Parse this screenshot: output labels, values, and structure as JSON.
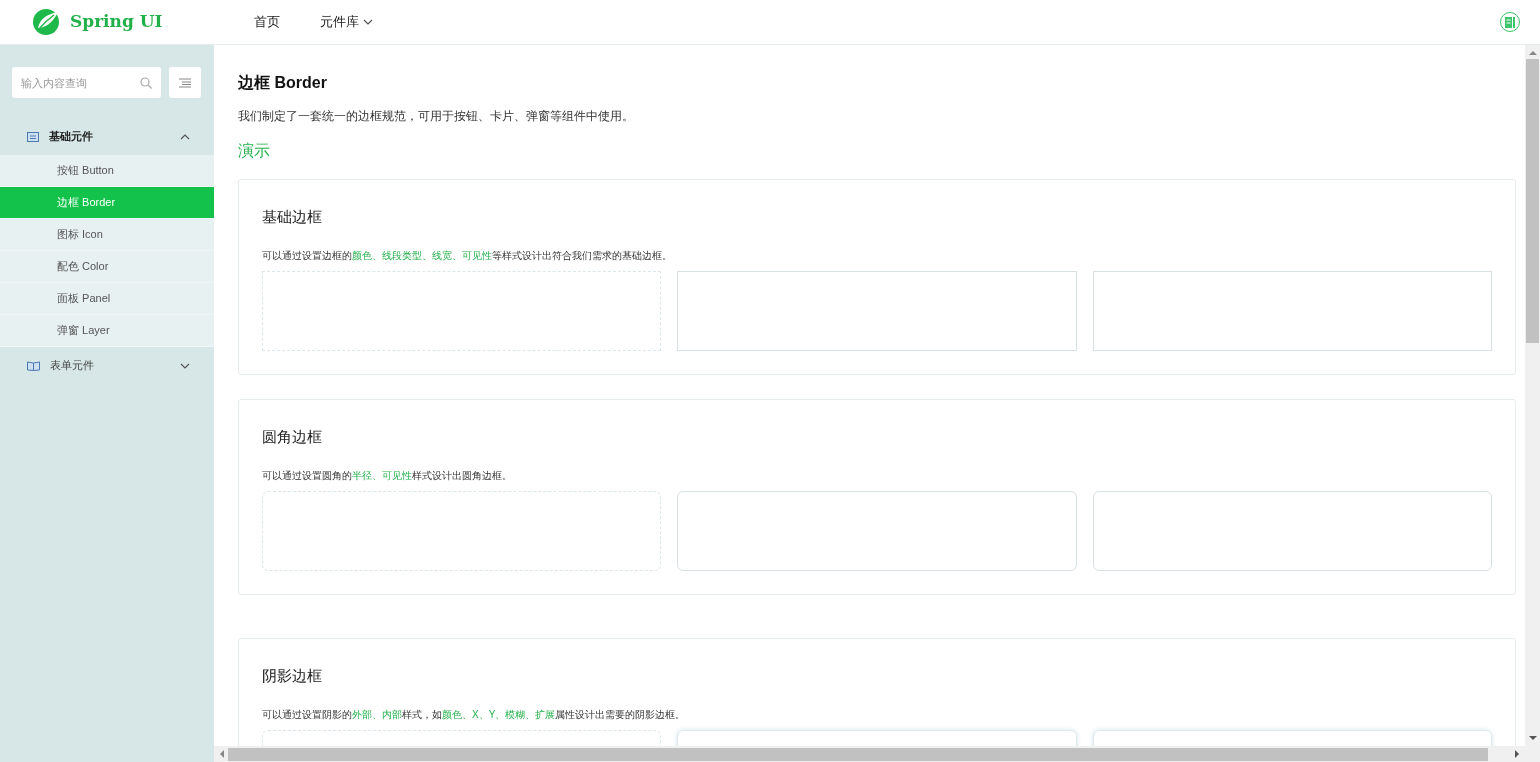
{
  "header": {
    "logo_text": "Spring UI",
    "nav": [
      {
        "label": "首页",
        "dropdown": false
      },
      {
        "label": "元件库",
        "dropdown": true
      }
    ]
  },
  "sidebar": {
    "search": {
      "placeholder": "输入内容查询"
    },
    "groups": [
      {
        "label": "基础元件",
        "expanded": true,
        "children": [
          {
            "label": "按钮 Button",
            "selected": false
          },
          {
            "label": "边框 Border",
            "selected": true
          },
          {
            "label": "图标 Icon",
            "selected": false
          },
          {
            "label": "配色 Color",
            "selected": false
          },
          {
            "label": "面板 Panel",
            "selected": false
          },
          {
            "label": "弹窗 Layer",
            "selected": false
          }
        ]
      },
      {
        "label": "表单元件",
        "expanded": false
      }
    ]
  },
  "page": {
    "title": "边框 Border",
    "intro": "我们制定了一套统一的边框规范，可用于按钮、卡片、弹窗等组件中使用。",
    "demo_heading": "演示",
    "sections": [
      {
        "title": "基础边框",
        "rounded": false,
        "description": [
          {
            "text": "可以通过设置边框的",
            "highlight": false
          },
          {
            "text": "颜色、线段类型、线宽、可见性",
            "highlight": true
          },
          {
            "text": "等样式设计出符合我们需求的基础边框。",
            "highlight": false
          }
        ],
        "boxes": [
          {
            "kind": "dashed"
          },
          {
            "kind": "solid"
          },
          {
            "kind": "solid"
          }
        ]
      },
      {
        "title": "圆角边框",
        "rounded": true,
        "description": [
          {
            "text": "可以通过设置圆角的",
            "highlight": false
          },
          {
            "text": "半径、可见性",
            "highlight": true
          },
          {
            "text": "样式设计出圆角边框。",
            "highlight": false
          }
        ],
        "boxes": [
          {
            "kind": "dashed"
          },
          {
            "kind": "solid"
          },
          {
            "kind": "solid"
          }
        ]
      },
      {
        "title": "阴影边框",
        "rounded": true,
        "description": [
          {
            "text": "可以通过设置阴影的",
            "highlight": false
          },
          {
            "text": "外部、内部",
            "highlight": true
          },
          {
            "text": "样式，如",
            "highlight": false
          },
          {
            "text": "颜色、X、Y、模糊、扩展",
            "highlight": true
          },
          {
            "text": "属性设计出需要的阴影边框。",
            "highlight": false
          }
        ],
        "boxes": [
          {
            "kind": "dashed"
          },
          {
            "kind": "shadow"
          },
          {
            "kind": "shadow"
          }
        ]
      }
    ]
  }
}
